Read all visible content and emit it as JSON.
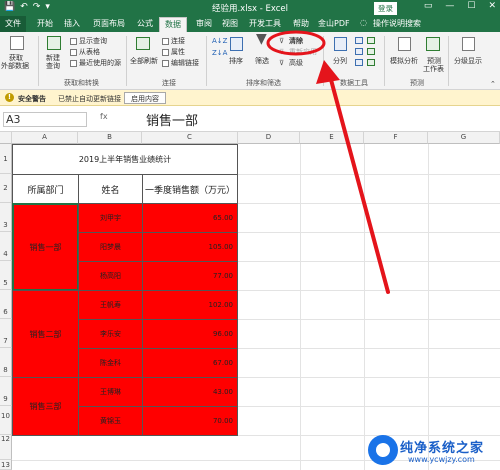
{
  "titlebar": {
    "title": "经验用.xlsx - Excel",
    "qat": [
      "💾",
      "↶",
      "↷",
      "▾"
    ],
    "login": "登录",
    "winbtns": [
      "▭",
      "—",
      "☐",
      "✕"
    ]
  },
  "tabs": {
    "file": "文件",
    "items": [
      "开始",
      "插入",
      "页面布局",
      "公式",
      "数据",
      "审阅",
      "视图",
      "开发工具",
      "帮助",
      "金山PDF",
      "操作说明搜索"
    ],
    "active_index": 4
  },
  "ribbon": {
    "get_external": "获取",
    "get_external2": "外部数据",
    "new_query": "新建",
    "new_query2": "查询",
    "show_queries": "显示查询",
    "from_table": "从表格",
    "recent_sources": "最近使用的源",
    "group_get": "获取和转换",
    "refresh_all": "全部刷新",
    "connections": "连接",
    "properties": "属性",
    "edit_links": "编辑链接",
    "group_conn": "连接",
    "sort_az": "A↓Z",
    "sort_za": "Z↓A",
    "sort": "排序",
    "filter": "筛选",
    "clear": "清除",
    "reapply": "重新应用",
    "advanced": "高级",
    "group_sort": "排序和筛选",
    "text_to_cols": "分列",
    "group_tools": "数据工具",
    "whatif": "模拟分析",
    "forecast": "预测",
    "forecast_sheet": "工作表",
    "group_forecast": "预测",
    "outline": "分级显示"
  },
  "secbar": {
    "icon": "!",
    "title": "安全警告",
    "message": "已禁止自动更新链接",
    "button": "启用内容"
  },
  "formula": {
    "namebox": "A3",
    "content": "销售一部",
    "fx": "fx"
  },
  "grid": {
    "columns": [
      "A",
      "B",
      "C",
      "D",
      "E",
      "F",
      "G"
    ],
    "rows": [
      "1",
      "2",
      "3",
      "4",
      "5",
      "6",
      "7",
      "8",
      "9",
      "10",
      "11",
      "12",
      "13"
    ]
  },
  "table": {
    "title": "2019上半年销售业绩统计",
    "headers": [
      "所属部门",
      "姓名",
      "一季度销售额（万元）"
    ],
    "departments": [
      "销售一部",
      "销售二部",
      "销售三部"
    ],
    "names": [
      "刘甲宇",
      "阳梦晨",
      "杨高阳",
      "王帆寿",
      "李乐安",
      "陈金科",
      "王博琳",
      "黄锦玉"
    ],
    "values": [
      "65.00",
      "105.00",
      "77.00",
      "102.00",
      "96.00",
      "67.00",
      "43.00",
      "70.00"
    ],
    "fill_color": "#ff0000"
  },
  "watermark": {
    "text": "纯净系统之家",
    "url": "www.ycwjzy.com"
  }
}
